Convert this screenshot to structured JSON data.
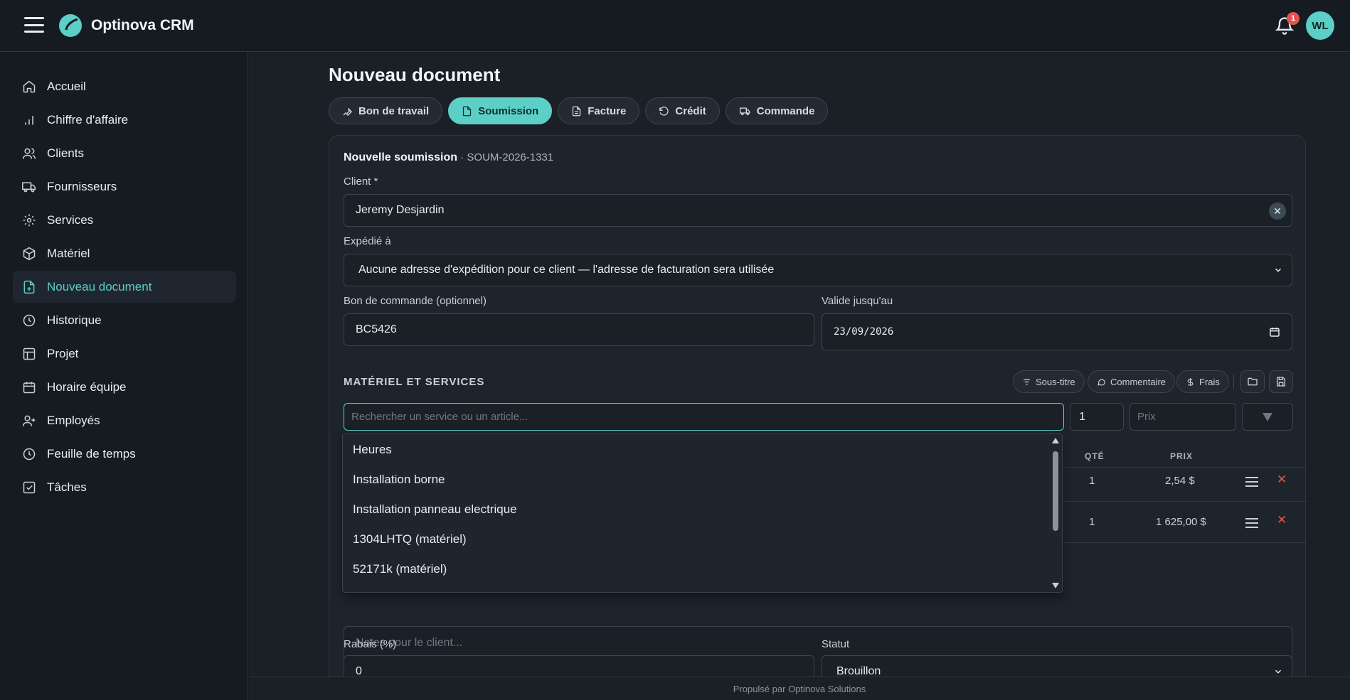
{
  "app": {
    "title": "Optinova CRM",
    "notification_count": "1",
    "user_initials": "WL"
  },
  "sidebar": {
    "items": [
      {
        "label": "Accueil",
        "icon": "home-icon"
      },
      {
        "label": "Chiffre d'affaire",
        "icon": "bar-chart-icon"
      },
      {
        "label": "Clients",
        "icon": "users-icon"
      },
      {
        "label": "Fournisseurs",
        "icon": "truck-icon"
      },
      {
        "label": "Services",
        "icon": "gear-icon"
      },
      {
        "label": "Matériel",
        "icon": "box-icon"
      },
      {
        "label": "Nouveau document",
        "icon": "file-plus-icon",
        "active": true
      },
      {
        "label": "Historique",
        "icon": "clock-icon"
      },
      {
        "label": "Projet",
        "icon": "layout-icon"
      },
      {
        "label": "Horaire équipe",
        "icon": "calendar-icon"
      },
      {
        "label": "Employés",
        "icon": "user-plus-icon"
      },
      {
        "label": "Feuille de temps",
        "icon": "clock-icon"
      },
      {
        "label": "Tâches",
        "icon": "check-square-icon"
      }
    ]
  },
  "page": {
    "title": "Nouveau document"
  },
  "doc_tabs": [
    {
      "label": "Bon de travail",
      "icon": "wrench-icon"
    },
    {
      "label": "Soumission",
      "icon": "file-icon",
      "active": true
    },
    {
      "label": "Facture",
      "icon": "file-text-icon"
    },
    {
      "label": "Crédit",
      "icon": "rotate-ccw-icon"
    },
    {
      "label": "Commande",
      "icon": "truck-icon"
    }
  ],
  "form": {
    "title": "Nouvelle soumission",
    "separator": " · ",
    "number": "SOUM-2026-1331",
    "client_label": "Client *",
    "client_value": "Jeremy Desjardin",
    "ship_label": "Expédié à",
    "ship_value": "Aucune adresse d'expédition pour ce client — l'adresse de facturation sera utilisée",
    "po_label": "Bon de commande (optionnel)",
    "po_value": "BC5426",
    "valid_label": "Valide jusqu'au",
    "valid_value": "23/09/2026",
    "discount_label": "Rabais (%)",
    "discount_value": "0",
    "status_label": "Statut",
    "status_value": "Brouillon",
    "notes_placeholder": "Notes pour le client..."
  },
  "items": {
    "section_title": "MATÉRIEL ET SERVICES",
    "btn_subtitle": "Sous-titre",
    "btn_comment": "Commentaire",
    "btn_fees": "Frais",
    "search_placeholder": "Rechercher un service ou un article...",
    "qty_default": "1",
    "price_placeholder": "Prix",
    "col_qty": "QTÉ",
    "col_price": "PRIX",
    "rows": [
      {
        "qty": "1",
        "price": "2,54 $"
      },
      {
        "qty": "1",
        "price": "1 625,00 $"
      }
    ]
  },
  "dropdown": {
    "options": [
      "Heures",
      "Installation borne",
      "Installation panneau electrique",
      "1304LHTQ (matériel)",
      "52171k (matériel)"
    ]
  },
  "footer": {
    "text": "Propulsé par Optinova Solutions"
  },
  "colors": {
    "accent": "#5ccfc6",
    "danger": "#e5534b",
    "background": "#1b2027"
  }
}
